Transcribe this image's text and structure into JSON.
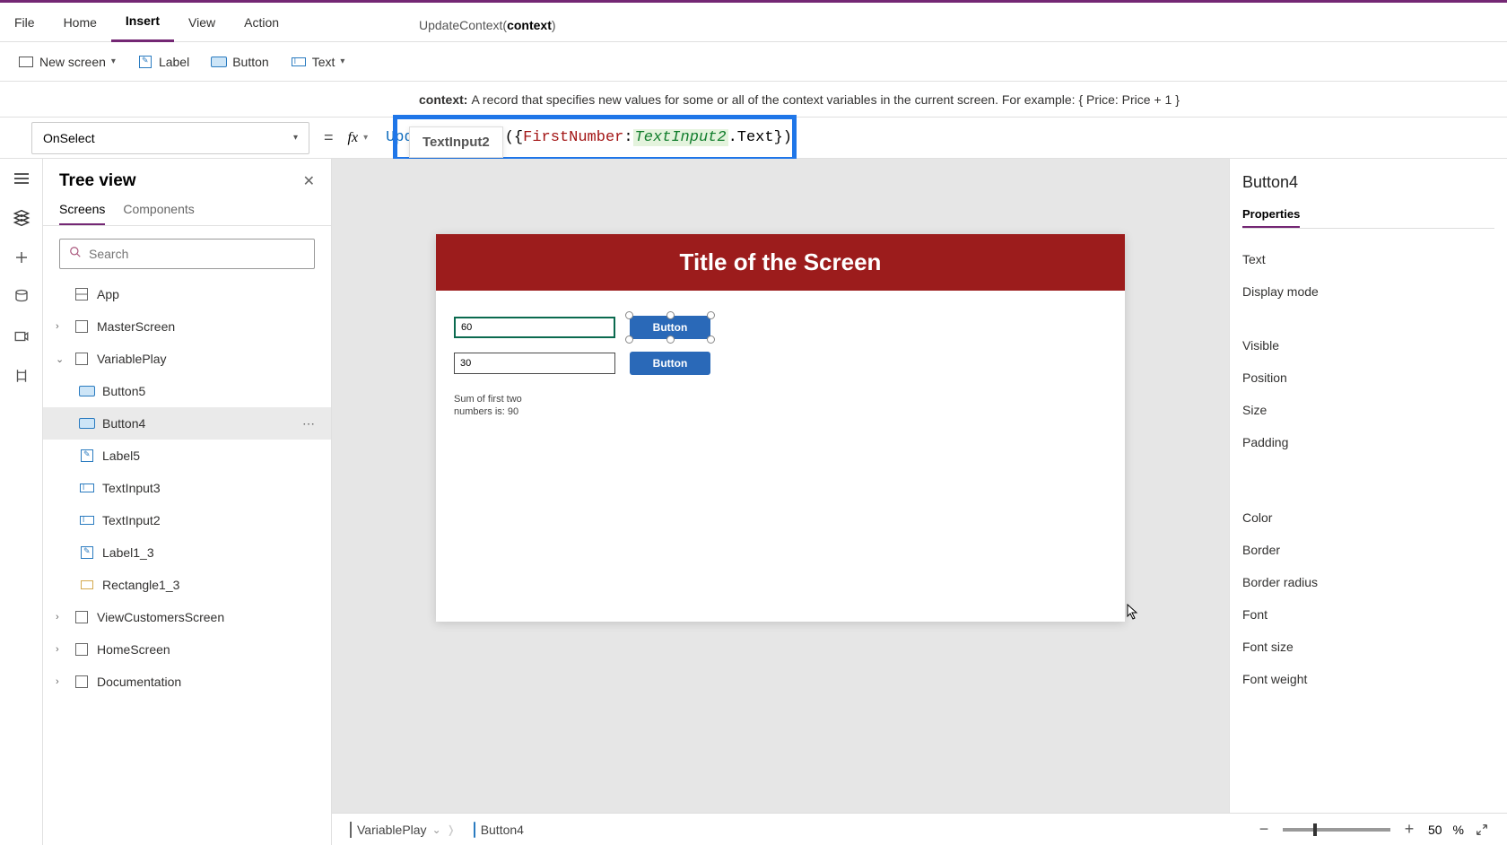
{
  "menu": {
    "file": "File",
    "home": "Home",
    "insert": "Insert",
    "view": "View",
    "action": "Action"
  },
  "intellisense": {
    "fn": "UpdateContext",
    "arg": "context"
  },
  "ribbon": {
    "newscreen": "New screen",
    "label": "Label",
    "button": "Button",
    "text": "Text"
  },
  "context_help": {
    "label": "context:",
    "desc": "A record that specifies new values for some or all of the context variables in the current screen. For example: { Price: Price + 1 }"
  },
  "property_select": "OnSelect",
  "formula": {
    "fn": "UpdateContext",
    "open": "({",
    "key": "FirstNumber",
    "colon": ": ",
    "ref": "TextInput2",
    "dot": ".",
    "prop": "Text",
    "close": "})"
  },
  "autocomplete": "TextInput2",
  "tree": {
    "title": "Tree view",
    "tab_screens": "Screens",
    "tab_components": "Components",
    "search_ph": "Search",
    "app": "App",
    "items": {
      "master": "MasterScreen",
      "variableplay": "VariablePlay",
      "button5": "Button5",
      "button4": "Button4",
      "label5": "Label5",
      "textinput3": "TextInput3",
      "textinput2": "TextInput2",
      "label13": "Label1_3",
      "rectangle13": "Rectangle1_3",
      "viewcust": "ViewCustomersScreen",
      "homescreen": "HomeScreen",
      "documentation": "Documentation"
    }
  },
  "canvas": {
    "title": "Title of the Screen",
    "input1": "60",
    "input2": "30",
    "btn1": "Button",
    "btn2": "Button",
    "sumlabel": "Sum of first two numbers is: 90"
  },
  "rightpanel": {
    "title": "Button4",
    "tab": "Properties",
    "props": {
      "text": "Text",
      "displaymode": "Display mode",
      "visible": "Visible",
      "position": "Position",
      "size": "Size",
      "padding": "Padding",
      "color": "Color",
      "border": "Border",
      "borderradius": "Border radius",
      "font": "Font",
      "fontsize": "Font size",
      "fontweight": "Font weight"
    }
  },
  "status": {
    "breadcrumb1": "VariablePlay",
    "breadcrumb2": "Button4",
    "zoom": "50",
    "pct": "%"
  }
}
